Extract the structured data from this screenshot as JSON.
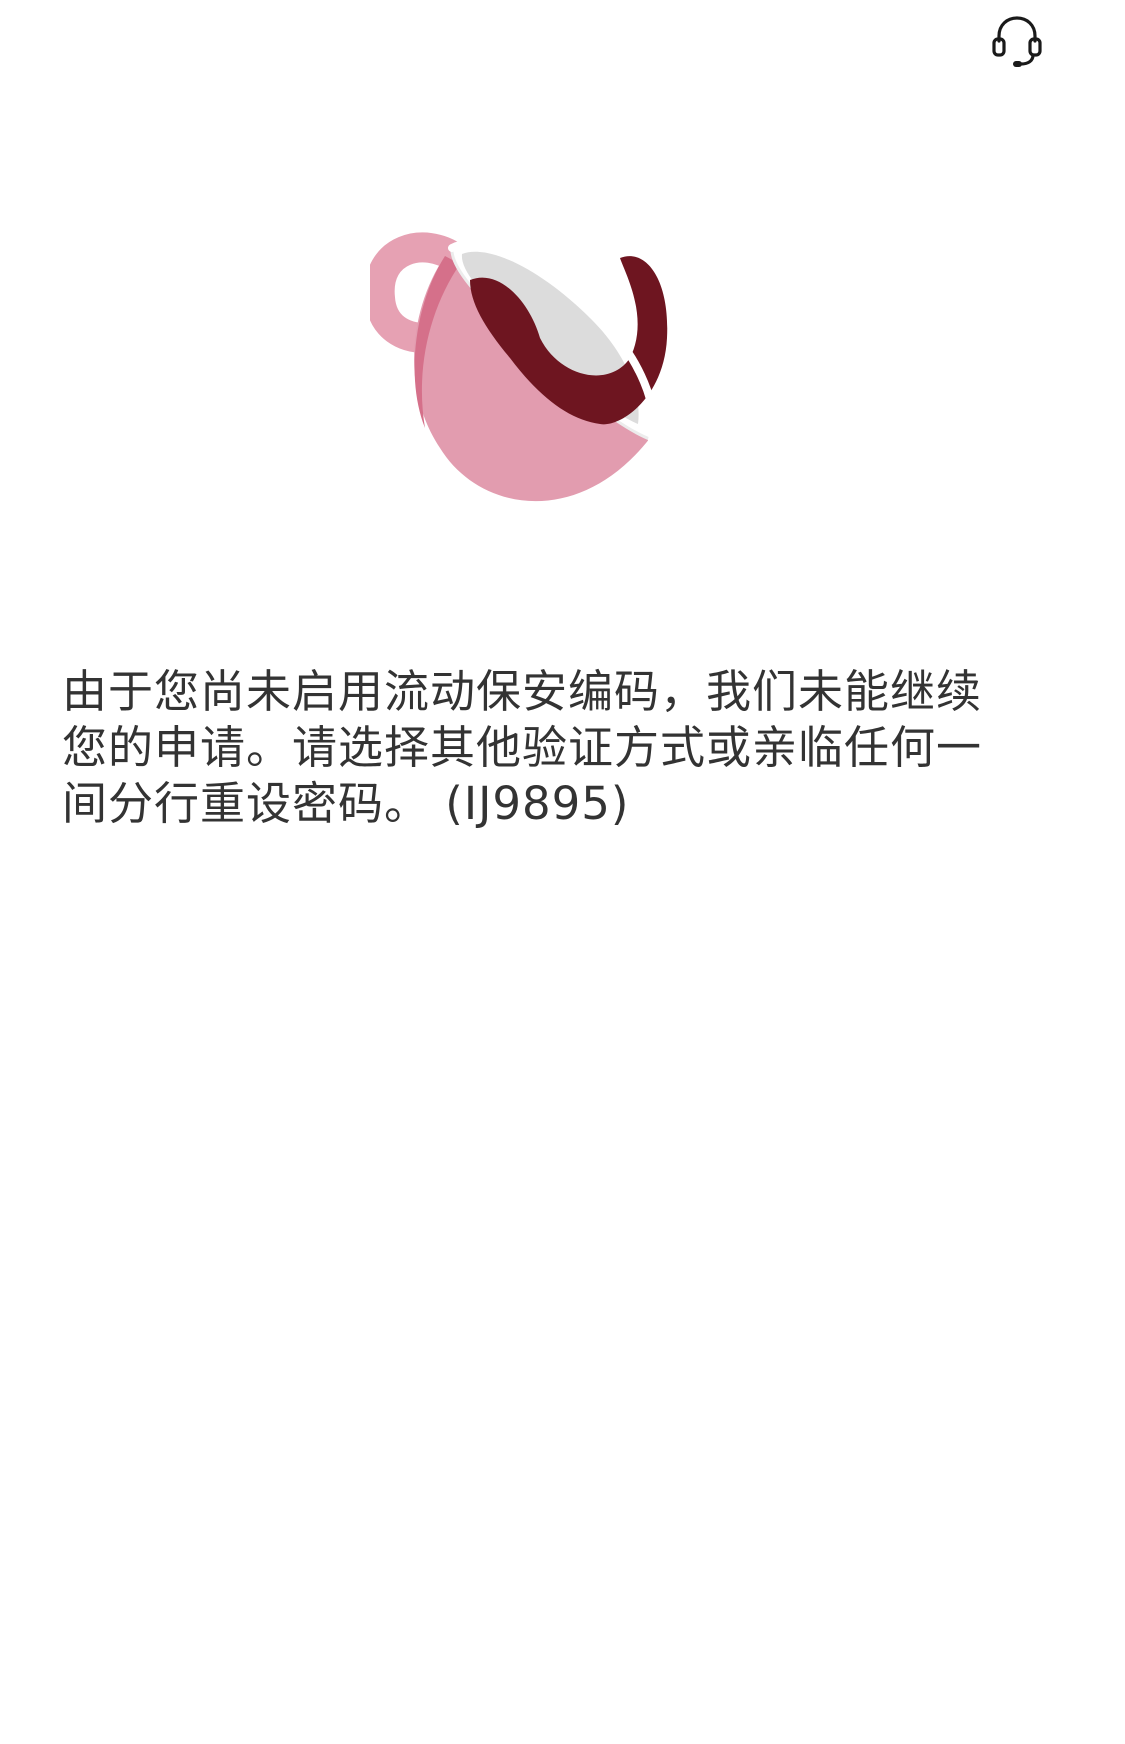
{
  "header": {
    "support_icon": "headset-icon"
  },
  "illustration": {
    "icon": "tipped-coffee-cup-illustration",
    "colors": {
      "cup_body": "#e29caf",
      "cup_side": "#d5708a",
      "handle": "#e6a1b3",
      "rim": "#ffffff",
      "cup_inner": "#dcdcdc",
      "spill": "#6e1520"
    }
  },
  "message": {
    "text": "由于您尚未启用流动保安编码，我们未能继续您的申请。请选择其他验证方式或亲临任何一间分行重设密码。 (IJ9895)"
  }
}
